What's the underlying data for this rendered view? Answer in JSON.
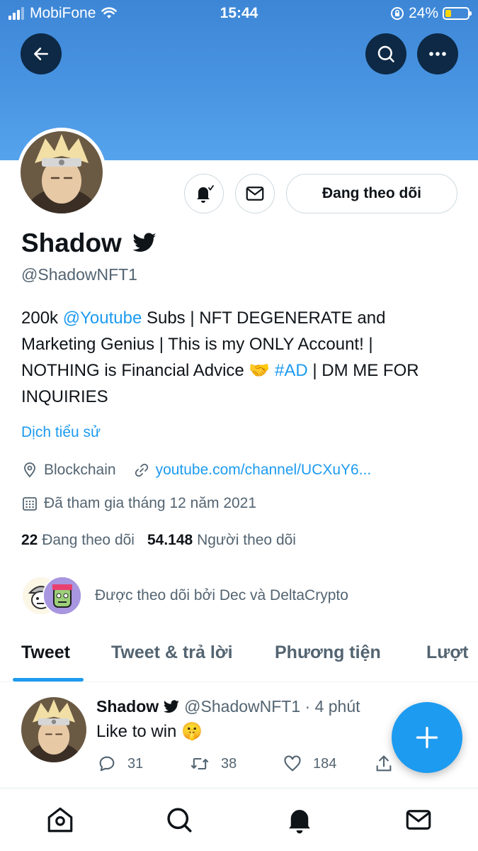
{
  "status": {
    "carrier": "MobiFone",
    "time": "15:44",
    "battery": "24%"
  },
  "header": {
    "back_icon": "arrow-left-icon",
    "search_icon": "search-icon",
    "more_icon": "more-icon"
  },
  "profile": {
    "name": "Shadow",
    "handle": "@ShadowNFT1",
    "follow_button": "Đang theo dõi",
    "bio": {
      "p1": "200k ",
      "mention": "@Youtube",
      "p2": " Subs | NFT DEGENERATE and Marketing Genius | This is my ONLY Account! | NOTHING is Financial Advice 🤝 ",
      "hashtag": "#AD",
      "p3": " | DM ME FOR INQUIRIES"
    },
    "translate": "Dịch tiểu sử",
    "location": "Blockchain",
    "website": "youtube.com/channel/UCXuY6...",
    "joined": "Đã tham gia tháng 12 năm 2021",
    "following_count": "22",
    "following_label": "Đang theo dõi",
    "followers_count": "54.148",
    "followers_label": "Người theo dõi",
    "followed_by": "Được theo dõi bởi Dec và DeltaCrypto"
  },
  "tabs": [
    "Tweet",
    "Tweet & trả lời",
    "Phương tiện",
    "Lượt"
  ],
  "tweet": {
    "name": "Shadow",
    "handle_time": "@ShadowNFT1 · 4 phút",
    "text": "Like to win 🤫",
    "replies": "31",
    "retweets": "38",
    "likes": "184"
  },
  "colors": {
    "accent": "#1d9bf0",
    "banner": "#4a96e3",
    "text_secondary": "#536471"
  }
}
